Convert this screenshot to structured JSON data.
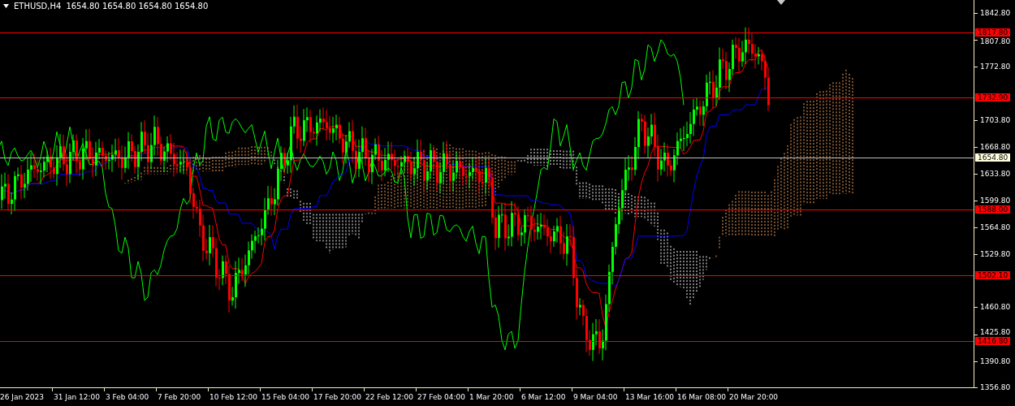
{
  "header": {
    "symbol": "ETHUSD,H4",
    "quotes": "1654.80 1654.80 1654.80 1654.80"
  },
  "price_axis": {
    "ticks": [
      "1842.80",
      "1807.80",
      "1772.80",
      "1703.80",
      "1668.80",
      "1633.80",
      "1599.80",
      "1564.80",
      "1529.80",
      "1460.80",
      "1425.80",
      "1390.80",
      "1356.80"
    ]
  },
  "levels": [
    {
      "label": "1817.80",
      "color": "#ff0000",
      "kind": "alert"
    },
    {
      "label": "1732.90",
      "color": "#ff0000",
      "kind": "alert"
    },
    {
      "label": "1654.80",
      "color": "#c0c0c0",
      "kind": "current"
    },
    {
      "label": "1588.00",
      "color": "#ff0000",
      "kind": "alert"
    },
    {
      "label": "1502.10",
      "color": "#ff0000",
      "kind": "alert"
    },
    {
      "label": "1416.80",
      "color": "#ff0000",
      "kind": "alert"
    }
  ],
  "time_axis": {
    "ticks": [
      "26 Jan 2023",
      "31 Jan 12:00",
      "3 Feb 04:00",
      "7 Feb 20:00",
      "10 Feb 12:00",
      "15 Feb 04:00",
      "17 Feb 20:00",
      "22 Feb 12:00",
      "27 Feb 04:00",
      "1 Mar 20:00",
      "6 Mar 12:00",
      "9 Mar 04:00",
      "13 Mar 16:00",
      "16 Mar 08:00",
      "20 Mar 20:00"
    ]
  }
}
